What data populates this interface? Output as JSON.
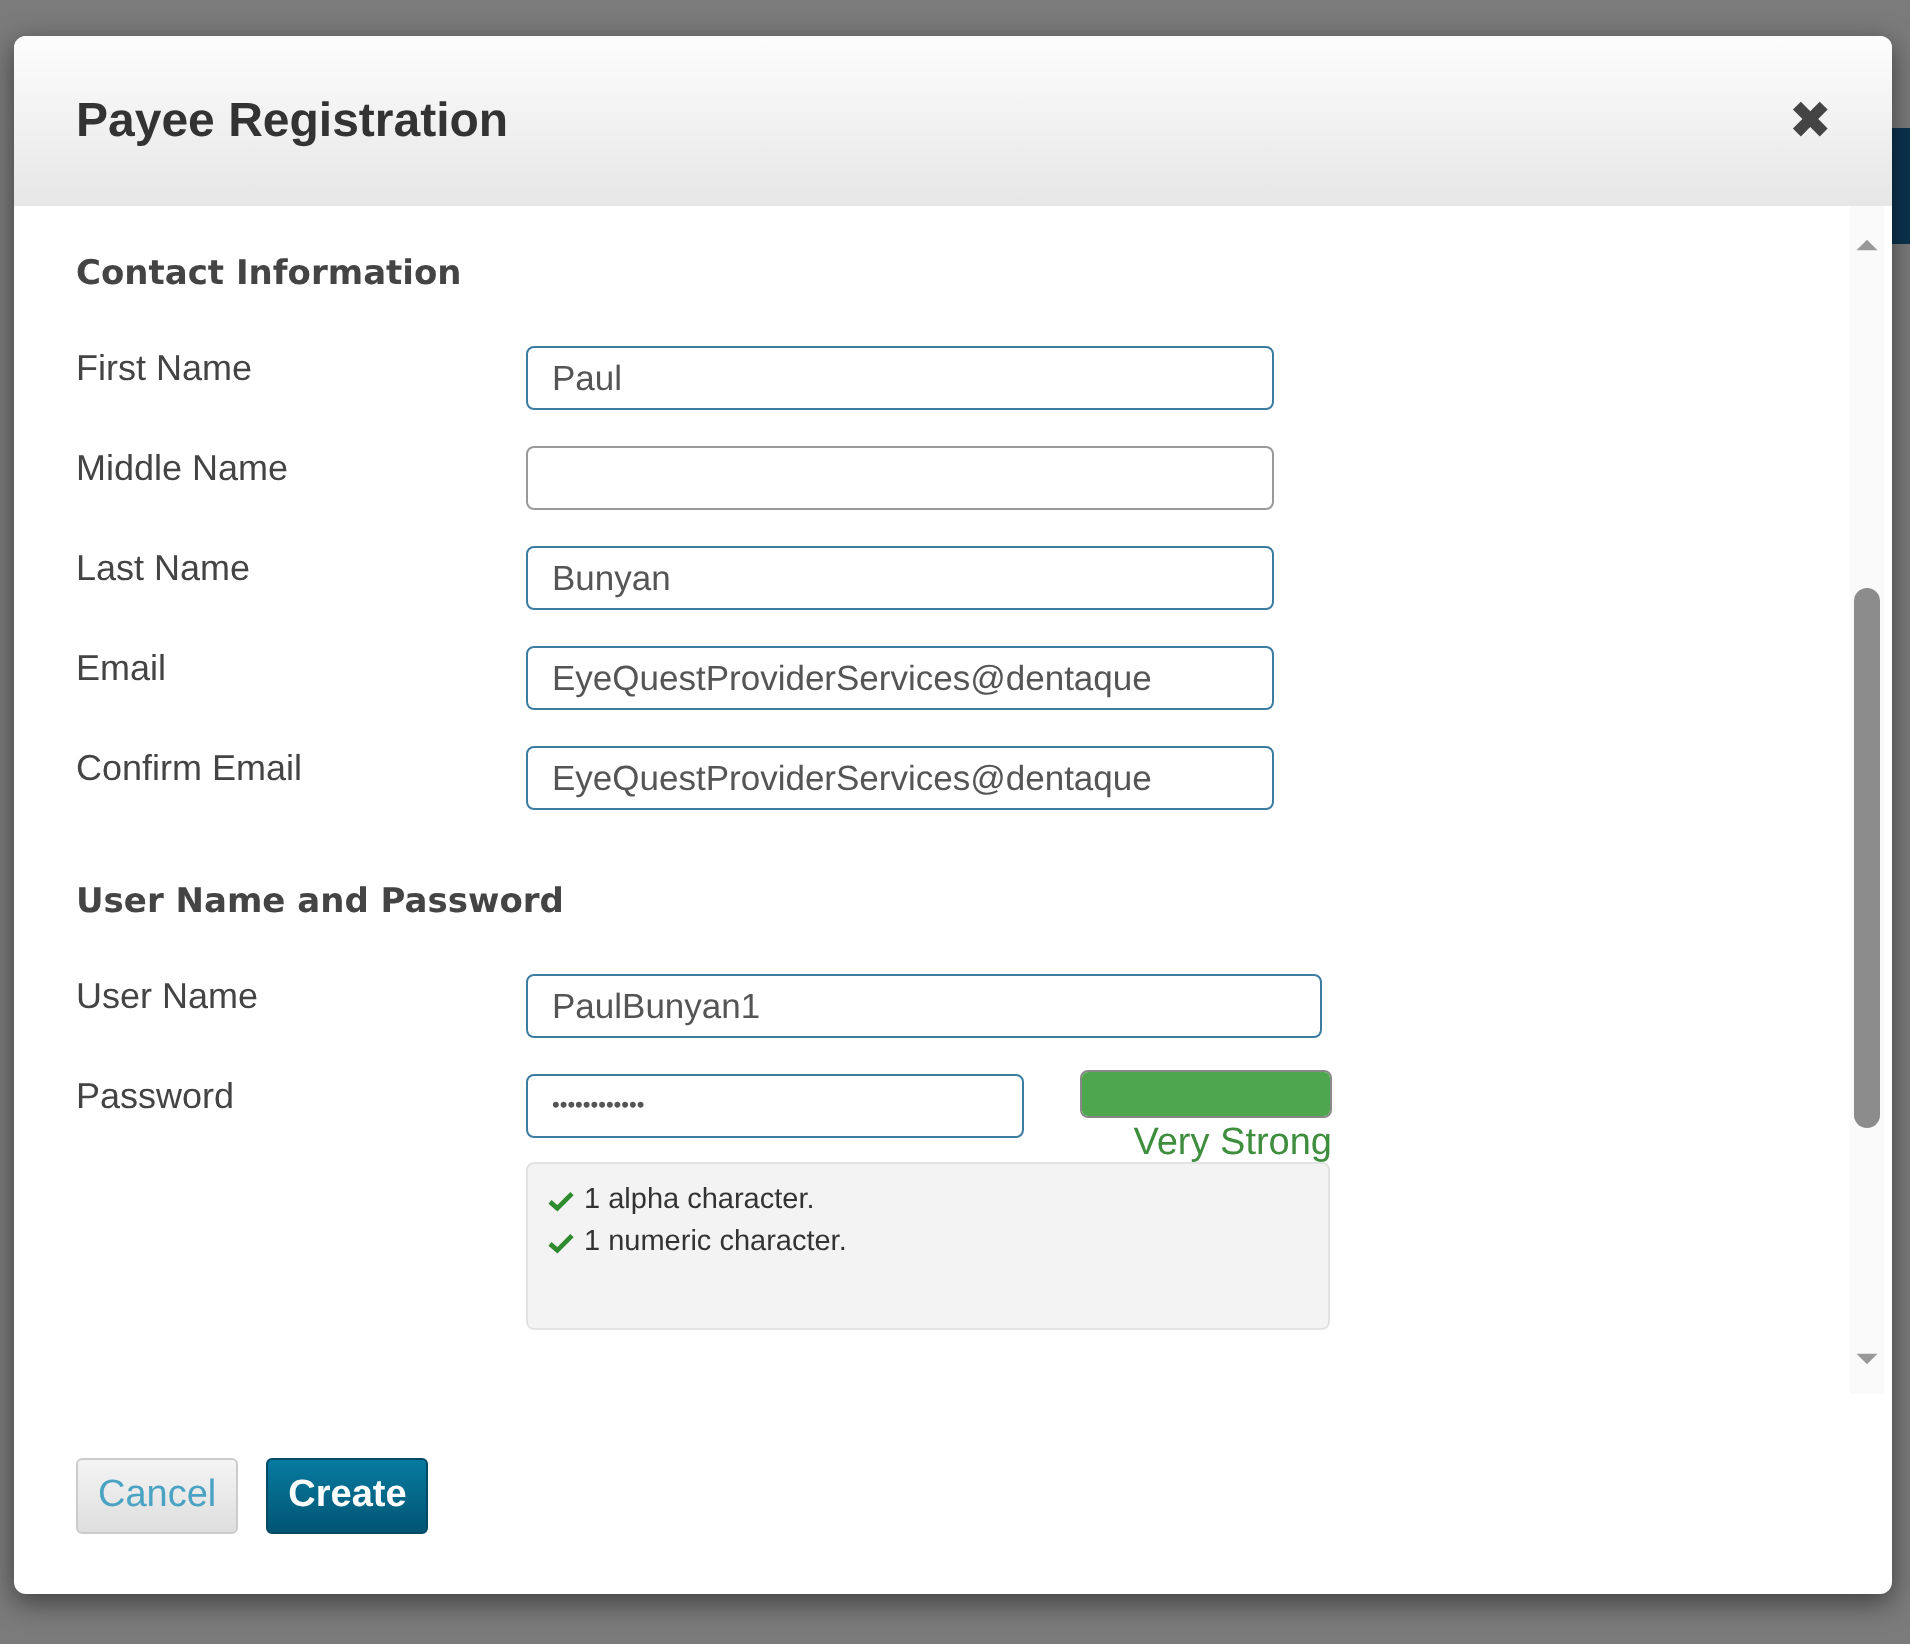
{
  "dialog": {
    "title": "Payee Registration",
    "close": "✖"
  },
  "sections": [
    {
      "heading": "Contact Information",
      "fields": [
        {
          "label": "First Name",
          "value": "Paul",
          "kind": "text"
        },
        {
          "label": "Middle Name",
          "kind": "text"
        },
        {
          "label": "Last Name",
          "value": "Bunyan",
          "kind": "text"
        },
        {
          "label": "Email",
          "value": "EyeQuestProviderServices@dentaque",
          "kind": "text"
        },
        {
          "label": "Confirm Email",
          "value": "EyeQuestProviderServices@dentaque",
          "kind": "text"
        }
      ]
    },
    {
      "heading": "User Name and Password",
      "fields": [
        {
          "label": "User Name",
          "value": "PaulBunyan1",
          "kind": "username"
        },
        {
          "label": "Password",
          "value": "••••••••••••",
          "kind": "password",
          "strength": {
            "level": 1,
            "label": "Very Strong"
          },
          "requirements": [
            {
              "text": "1 alpha character.",
              "met": true
            },
            {
              "text": "1 numeric character.",
              "met": true
            }
          ]
        }
      ]
    }
  ],
  "buttons": [
    {
      "label": "Cancel",
      "kind": "secondary"
    },
    {
      "label": "Create",
      "kind": "primary"
    }
  ]
}
